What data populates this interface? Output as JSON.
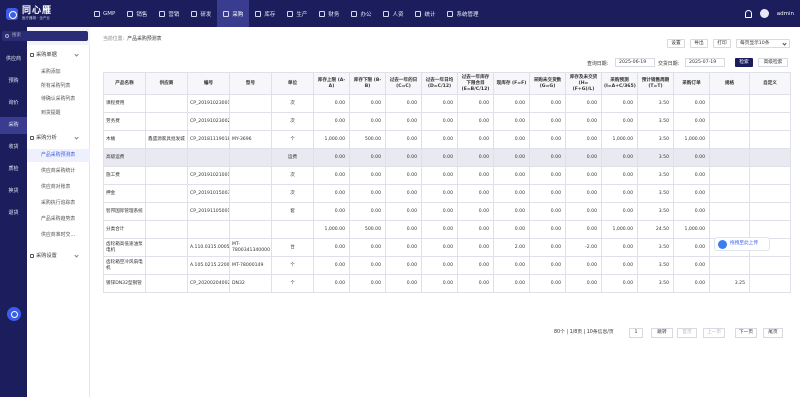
{
  "brand": {
    "name": "同心雁",
    "slogan": "医疗器械 · 全产业"
  },
  "topnav": [
    "GMP",
    "销售",
    "营销",
    "研发",
    "采购",
    "库存",
    "生产",
    "财务",
    "办公",
    "人资",
    "统计",
    "系统管理"
  ],
  "topnav_active": "采购",
  "user": {
    "name": "admin"
  },
  "sidebar": {
    "search_placeholder": "搜索",
    "items": [
      "供应商",
      "预购",
      "询价",
      "采购",
      "收货",
      "质检",
      "换货",
      "退货"
    ],
    "active": "采购"
  },
  "submenu": {
    "group1": "采购单据",
    "group1_items": [
      "采购添加",
      "所有采购列表",
      "待确认采购列表",
      "到货提醒"
    ],
    "group2": "采购分析",
    "group2_items": [
      "产品采购预测表",
      "供应商采购统计",
      "供应商对账表",
      "采购执行追踪表",
      "产品采购趋势表",
      "供应商准时交..."
    ],
    "group3": "采购设置",
    "active_item": "产品采购预测表"
  },
  "breadcrumb": {
    "prefix": "当前位置:",
    "current": "产品采购预测表"
  },
  "toolbar": {
    "settings": "设置",
    "export": "导出",
    "print": "打印",
    "page_size": "每页显示10条"
  },
  "filters": {
    "query_date_label": "查询日期:",
    "query_date": "2025-06-19",
    "delivery_date_label": "交货日期:",
    "delivery_date": "2025-07-19",
    "search": "检索",
    "advanced": "高级检索"
  },
  "table": {
    "headers": [
      "产品名称",
      "供应商",
      "编号",
      "型号",
      "单位",
      "库存上限 (A-A)",
      "库存下限 (B-B)",
      "过去一年的日 (C=C)",
      "过去一年日均 (D=C/12)",
      "过去一年库存下限合目 (E=B/C/12)",
      "现库存 (F=F)",
      "采购未交货数 (G=G)",
      "库存及未交货 (H=(F+G)/L)",
      "采购预测 (I=A+C/365)",
      "预计销售周期 (T=T)",
      "采购订单",
      "规格",
      "自定义"
    ],
    "rows": [
      [
        "课程费用",
        "",
        "CP_20191023001",
        "",
        "次",
        "0.00",
        "0.00",
        "0.00",
        "0.00",
        "0.00",
        "0.00",
        "0.00",
        "0.00",
        "0.00",
        "3.50",
        "0.00",
        "",
        ""
      ],
      [
        "劳务费",
        "",
        "CP_20191023002",
        "",
        "次",
        "0.00",
        "0.00",
        "0.00",
        "0.00",
        "0.00",
        "0.00",
        "0.00",
        "0.00",
        "0.00",
        "3.50",
        "0.00",
        "",
        ""
      ],
      [
        "木桶",
        "鑫盛源家具批发城",
        "CP_20181119018",
        "MY-3696",
        "个",
        "1,000.00",
        "500.00",
        "0.00",
        "0.00",
        "0.00",
        "0.00",
        "0.00",
        "0.00",
        "1,000.00",
        "3.50",
        "1,000.00",
        "",
        ""
      ],
      [
        "高级运费",
        "",
        "",
        "",
        "运费",
        "0.00",
        "0.00",
        "0.00",
        "0.00",
        "0.00",
        "0.00",
        "0.00",
        "0.00",
        "0.00",
        "3.50",
        "0.00",
        "",
        ""
      ],
      [
        "施工费",
        "",
        "CP_20191021001",
        "",
        "次",
        "0.00",
        "0.00",
        "0.00",
        "0.00",
        "0.00",
        "0.00",
        "0.00",
        "0.00",
        "0.00",
        "3.50",
        "0.00",
        "",
        ""
      ],
      [
        "押金",
        "",
        "CP_20191015003",
        "",
        "次",
        "0.00",
        "0.00",
        "0.00",
        "0.00",
        "0.00",
        "0.00",
        "0.00",
        "0.00",
        "0.00",
        "3.50",
        "0.00",
        "",
        ""
      ],
      [
        "智邦国际管理系统",
        "",
        "CP_20191105001",
        "",
        "套",
        "0.00",
        "0.00",
        "0.00",
        "0.00",
        "0.00",
        "0.00",
        "0.00",
        "0.00",
        "0.00",
        "3.50",
        "0.00",
        "",
        ""
      ],
      [
        "分类合计",
        "",
        "",
        "",
        "",
        "1,000.00",
        "500.00",
        "0.00",
        "0.00",
        "0.00",
        "0.00",
        "0.00",
        "0.00",
        "1,000.00",
        "24.50",
        "1,000.00",
        "",
        ""
      ],
      [
        "齿轮箱高低速油泵电机",
        "",
        "A.110.0315.00055",
        "MT-7800341340000",
        "台",
        "0.00",
        "0.00",
        "0.00",
        "0.00",
        "0.00",
        "2.00",
        "0.00",
        "-2.00",
        "0.00",
        "3.50",
        "0.00",
        "",
        ""
      ],
      [
        "齿轮箱空冷风扇电机",
        "",
        "A.105.0215.22007",
        "MT-78000149",
        "个",
        "0.00",
        "0.00",
        "0.00",
        "0.00",
        "0.00",
        "0.00",
        "0.00",
        "0.00",
        "0.00",
        "3.50",
        "0.00",
        "",
        ""
      ],
      [
        "镀锌DN32型钢管",
        "",
        "CP_20200204002",
        "DN32",
        "个",
        "0.00",
        "0.00",
        "0.00",
        "0.00",
        "0.00",
        "0.00",
        "0.00",
        "0.00",
        "0.00",
        "3.50",
        "0.00",
        "3.25",
        ""
      ]
    ],
    "grey_row_index": 3
  },
  "pager": {
    "summary": "80个 | 1/8页 | 10条信息/页",
    "page_input": "1",
    "jump": "跳转",
    "first": "首页",
    "prev": "上一页",
    "next": "下一页",
    "last": "尾页"
  },
  "float_badge": "拖拽至此上传"
}
